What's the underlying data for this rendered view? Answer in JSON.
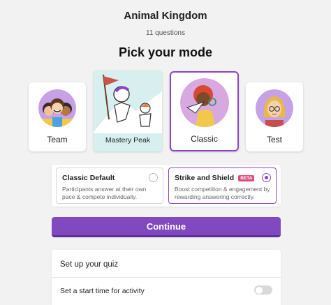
{
  "quiz": {
    "title": "Animal Kingdom",
    "question_count": "11 questions"
  },
  "heading": "Pick your mode",
  "modes": [
    {
      "label": "Team",
      "icon": "team-illustration"
    },
    {
      "label": "Mastery Peak",
      "icon": "mountain-climber-illustration"
    },
    {
      "label": "Classic",
      "icon": "paper-plane-illustration",
      "selected": true
    },
    {
      "label": "Test",
      "icon": "student-illustration"
    }
  ],
  "classic_options": [
    {
      "title": "Classic Default",
      "desc": "Participants answer at their own pace & compete individually.",
      "selected": false
    },
    {
      "title": "Strike and Shield",
      "badge": "BETA",
      "desc": "Boost competition & engagement by rewarding answering correctly.",
      "selected": true
    }
  ],
  "continue_label": "Continue",
  "setup": {
    "title": "Set up your quiz",
    "start_time_label": "Set a start time for activity",
    "start_time_enabled": false
  },
  "colors": {
    "accent": "#8149c0",
    "selected_border": "#8e44c7",
    "beta_badge": "#e14b7a"
  }
}
